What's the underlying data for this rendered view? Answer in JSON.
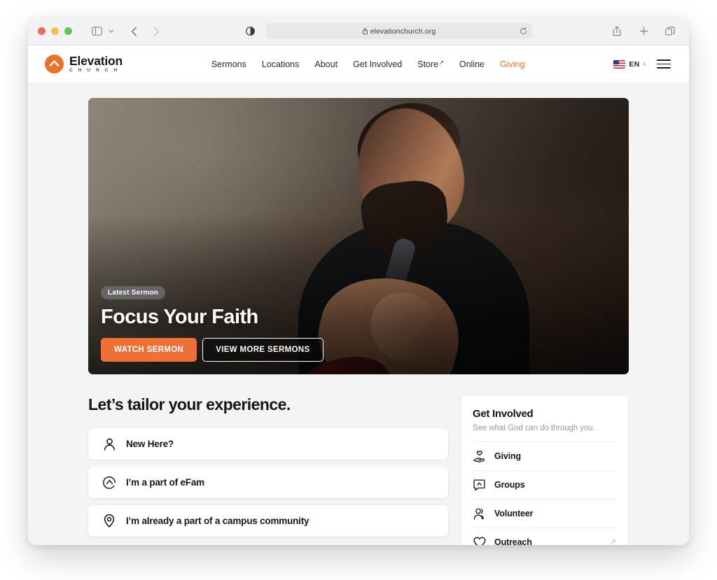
{
  "browser": {
    "url": "elevationchurch.org",
    "icons": {
      "sidebar": "sidebar-toggle-icon",
      "sidebar_chevron": "chevron-down-icon",
      "back": "back-arrow-icon",
      "forward": "forward-arrow-icon",
      "reader": "reader-mode-icon",
      "lock": "lock-icon",
      "reload": "reload-icon",
      "share": "share-icon",
      "new_tab": "plus-icon",
      "tab_overview": "tab-overview-icon"
    },
    "traffic_lights": [
      "close-red",
      "minimize-yellow",
      "maximize-green"
    ]
  },
  "site_header": {
    "logo": {
      "name": "Elevation",
      "subtitle": "C H U R C H",
      "mark": "elevation-chevron-logo"
    },
    "nav": [
      {
        "label": "Sermons",
        "external": false,
        "accent": false
      },
      {
        "label": "Locations",
        "external": false,
        "accent": false
      },
      {
        "label": "About",
        "external": false,
        "accent": false
      },
      {
        "label": "Get Involved",
        "external": false,
        "accent": false
      },
      {
        "label": "Store",
        "external": true,
        "accent": false
      },
      {
        "label": "Online",
        "external": false,
        "accent": false
      },
      {
        "label": "Giving",
        "external": false,
        "accent": true
      }
    ],
    "language": {
      "flag": "us-flag-icon",
      "code": "EN",
      "chevron": "›"
    },
    "menu_icon": "hamburger-menu-icon"
  },
  "hero": {
    "badge": "Latest Sermon",
    "title": "Focus Your Faith",
    "primary_button": "WATCH SERMON",
    "secondary_button": "VIEW MORE SERMONS",
    "image_alt": "Pastor smiling while holding a microphone"
  },
  "tailor": {
    "heading": "Let’s tailor your experience.",
    "options": [
      {
        "label": "New Here?",
        "icon": "person-icon"
      },
      {
        "label": "I’m a part of eFam",
        "icon": "elevation-circle-icon"
      },
      {
        "label": "I’m already a part of a campus community",
        "icon": "location-pin-icon"
      }
    ]
  },
  "get_involved": {
    "title": "Get Involved",
    "subtitle": "See what God can do through you.",
    "items": [
      {
        "label": "Giving",
        "icon": "hand-heart-icon",
        "external": false
      },
      {
        "label": "Groups",
        "icon": "groups-chat-icon",
        "external": false
      },
      {
        "label": "Volunteer",
        "icon": "volunteer-people-icon",
        "external": false
      },
      {
        "label": "Outreach",
        "icon": "heart-icon",
        "external": true
      }
    ]
  },
  "colors": {
    "brand_orange": "#ED7136",
    "logo_orange": "#E8732B",
    "page_bg": "#F4F4F5",
    "card_bg": "#FFFFFF",
    "text_dark": "#15151A",
    "text_muted": "#9A9AA0"
  }
}
